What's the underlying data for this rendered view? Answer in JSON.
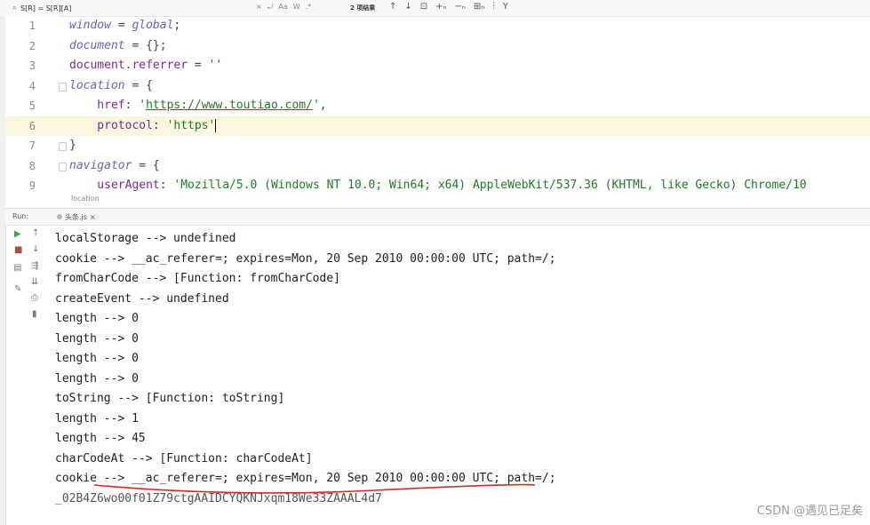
{
  "search": {
    "icon": "magnifier-icon",
    "query": "S[R] = S[R][A]",
    "tool_labels": [
      "×",
      "⤾",
      "Aa",
      "W",
      ".*"
    ],
    "match_count": "2 项结果",
    "nav_icons": [
      "↑",
      "↓",
      "⊡",
      "+ₙ",
      "−ₙ",
      "⊞ₙ",
      "⫶",
      "Y"
    ]
  },
  "editor": {
    "lines": [
      {
        "num": "1",
        "parts": [
          {
            "t": "window",
            "c": "k-var"
          },
          {
            "t": " = ",
            "c": "k-op"
          },
          {
            "t": "global",
            "c": "k-var"
          },
          {
            "t": ";",
            "c": "k-op"
          }
        ]
      },
      {
        "num": "2",
        "parts": [
          {
            "t": "document",
            "c": "k-var"
          },
          {
            "t": " = {};",
            "c": "k-op"
          }
        ]
      },
      {
        "num": "3",
        "parts": [
          {
            "t": "document.referrer",
            "c": "k-prop"
          },
          {
            "t": " = ",
            "c": "k-op"
          },
          {
            "t": "''",
            "c": "k-str"
          }
        ]
      },
      {
        "num": "4",
        "parts": [
          {
            "t": "location",
            "c": "k-var"
          },
          {
            "t": " = {",
            "c": "k-op"
          }
        ]
      },
      {
        "num": "5",
        "parts": [
          {
            "t": "    href",
            "c": "k-prop"
          },
          {
            "t": ": ",
            "c": "k-op"
          },
          {
            "t": "'",
            "c": "k-str"
          },
          {
            "t": "https://www.toutiao.com/",
            "c": "k-str url"
          },
          {
            "t": "'",
            "c": "k-str"
          },
          {
            "t": ",",
            "c": "k-op"
          }
        ]
      },
      {
        "num": "6",
        "parts": [
          {
            "t": "    protocol",
            "c": "k-prop"
          },
          {
            "t": ": ",
            "c": "k-op"
          },
          {
            "t": "'https'",
            "c": "k-str"
          }
        ]
      },
      {
        "num": "7",
        "parts": [
          {
            "t": "}",
            "c": "k-op"
          }
        ]
      },
      {
        "num": "8",
        "parts": [
          {
            "t": "navigator",
            "c": "k-var"
          },
          {
            "t": " = {",
            "c": "k-op"
          }
        ]
      },
      {
        "num": "9",
        "parts": [
          {
            "t": "    userAgent",
            "c": "k-prop"
          },
          {
            "t": ": ",
            "c": "k-op"
          },
          {
            "t": "'Mozilla/5.0 (Windows NT 10.0; Win64; x64) AppleWebKit/537.36 (KHTML, like Gecko) Chrome/10",
            "c": "k-str"
          }
        ]
      }
    ],
    "active_line": "6",
    "breadcrumb_hint": "location"
  },
  "run_panel": {
    "label": "Run:",
    "tab_label": "头条.js",
    "tab_close": "×",
    "toolbar_icons": [
      "play-icon",
      "up-arrow-icon",
      "stop-icon",
      "down-arrow-icon",
      "layout-icon",
      "wrap-icon",
      "scroll-icon",
      "pin-icon",
      "print-icon",
      "trash-icon"
    ]
  },
  "console": {
    "lines": [
      "localStorage --> undefined",
      "cookie --> __ac_referer=; expires=Mon, 20 Sep 2010 00:00:00 UTC; path=/;",
      "fromCharCode --> [Function: fromCharCode]",
      "createEvent --> undefined",
      "length --> 0",
      "length --> 0",
      "length --> 0",
      "length --> 0",
      "toString --> [Function: toString]",
      "length --> 1",
      "length --> 45",
      "charCodeAt --> [Function: charCodeAt]",
      "cookie --> __ac_referer=; expires=Mon, 20 Sep 2010 00:00:00 UTC; path=/;",
      "_02B4Z6wo00f01Z79ctgAAIDCYQKNJxqm18We33ZAAAL4d7"
    ],
    "annotation_color": "#d42a2a"
  },
  "watermark": "CSDN @遇见已足矣"
}
